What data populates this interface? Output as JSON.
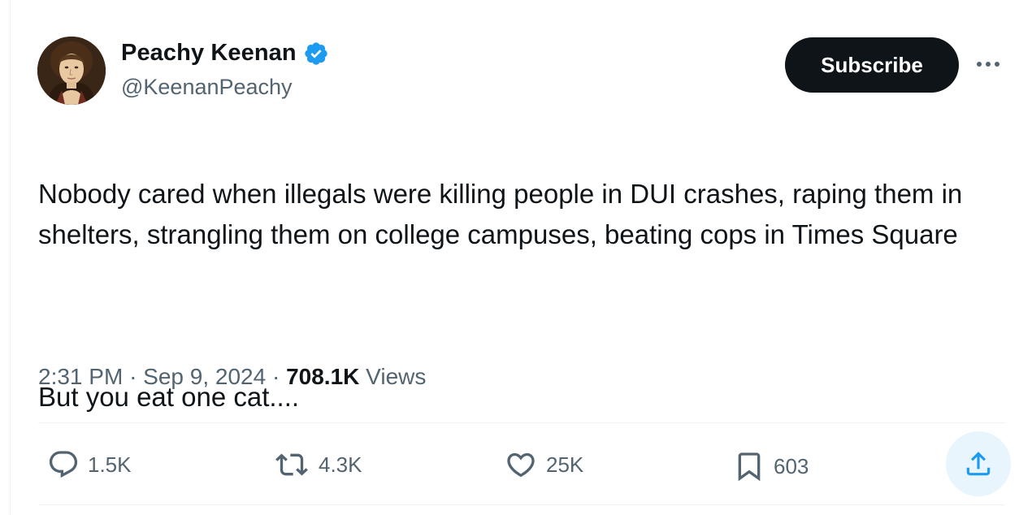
{
  "author": {
    "display_name": "Peachy Keenan",
    "handle": "@KeenanPeachy",
    "verified": true,
    "avatar_icon": "portrait-avatar"
  },
  "header": {
    "subscribe_label": "Subscribe",
    "more_icon": "more-horizontal-icon"
  },
  "tweet": {
    "paragraph_1": "Nobody cared when illegals were killing people in DUI crashes, raping them in shelters, strangling them on college campuses, beating cops in Times Square",
    "paragraph_2": "But you eat one cat...."
  },
  "meta": {
    "time": "2:31 PM",
    "separator": "·",
    "date": "Sep 9, 2024",
    "views_count": "708.1K",
    "views_label": "Views"
  },
  "actions": {
    "replies": "1.5K",
    "reposts": "4.3K",
    "likes": "25K",
    "bookmarks": "603"
  },
  "colors": {
    "text": "#0f1419",
    "secondary": "#536471",
    "verified_blue": "#1d9bf0",
    "share_bg": "#e8f5fd",
    "subscribe_bg": "#0f1419"
  }
}
